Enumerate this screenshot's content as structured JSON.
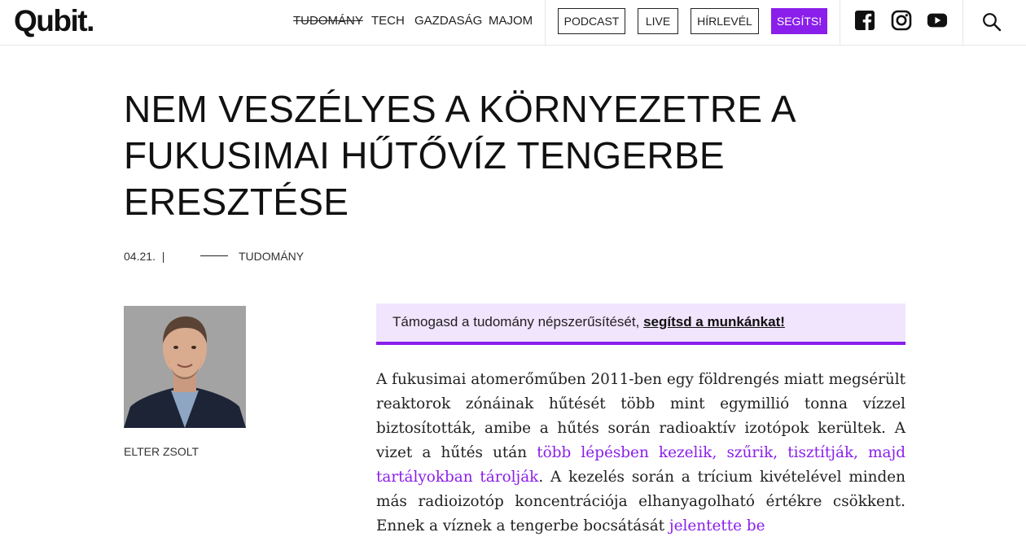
{
  "header": {
    "logo": "Qubit.",
    "nav": [
      "TUDOMÁNY",
      "TECH",
      "GAZDASÁG",
      "MAJOM"
    ],
    "buttons": [
      "PODCAST",
      "LIVE",
      "HÍRLEVÉL"
    ],
    "support_button": "SEGÍTS!",
    "social": [
      "facebook-icon",
      "instagram-icon",
      "youtube-icon"
    ],
    "search_icon": "search-icon",
    "accent_color": "#8a1eea"
  },
  "article": {
    "title": "NEM VESZÉLYES A KÖRNYEZETRE A FUKUSIMAI HŰTŐVÍZ TENGERBE ERESZTÉSE",
    "date": "04.21.",
    "date_sep": "|",
    "category": "TUDOMÁNY",
    "author": "ELTER ZSOLT",
    "support_text": "Támogasd a tudomány népszerűsítését, ",
    "support_link": "segítsd a munkánkat!",
    "body_p1": "A fukusimai atomerőműben 2011-ben egy földrengés miatt megsérült reaktorok zónáinak hűtését több mint egymillió tonna vízzel biztosították, amibe a hűtés során radioaktív izotópok kerültek. A vizet a hűtés után ",
    "body_link1": "több lépésben kezelik, szűrik, tisztítják, majd tartályokban tárolják",
    "body_p2": ". A kezelés során a trícium kivételével minden más radioizotóp koncentrációja elhanyagolható értékre csökkent. Ennek a víznek a tengerbe bocsátását ",
    "body_link2": "jelentette be"
  }
}
